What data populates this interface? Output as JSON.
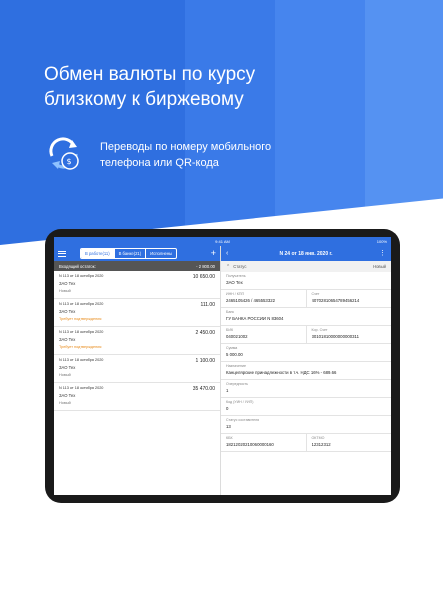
{
  "promo": {
    "headline_line1": "Обмен валюты по курсу",
    "headline_line2": "близкому к биржевому",
    "feature_line1": "Переводы по номеру мобильного",
    "feature_line2": "телефона или QR-кода"
  },
  "status_bar": {
    "time": "9:41 AM",
    "battery": "100%"
  },
  "left_panel": {
    "tabs": [
      "В работе(11)",
      "В банке(21)",
      "Исполнены"
    ],
    "balance_label": "Входящий остаток:",
    "balance_value": "- 2 800.00",
    "documents": [
      {
        "title": "N 113 от 18 октября 2020",
        "amount": "10 650.00",
        "company": "ЗАО Тех",
        "status": "Новый",
        "status_type": "normal"
      },
      {
        "title": "N 113 от 18 октября 2020",
        "amount": "111.00",
        "company": "ЗАО Тех",
        "status": "Требует подтверждения",
        "status_type": "warn"
      },
      {
        "title": "N 113 от 18 октября 2020",
        "amount": "2 450.00",
        "company": "ЗАО Тех",
        "status": "Требует подтверждения",
        "status_type": "warn"
      },
      {
        "title": "N 113 от 18 октября 2020",
        "amount": "1 100.00",
        "company": "ЗАО Тех",
        "status": "Новый",
        "status_type": "normal"
      },
      {
        "title": "N 113 от 18 октября 2020",
        "amount": "35 470.00",
        "company": "ЗАО Тех",
        "status": "Новый",
        "status_type": "normal"
      }
    ]
  },
  "right_panel": {
    "title": "N 24 от 18 янв. 2020 г.",
    "status_label": "Статус",
    "status_value": "Новый",
    "recipient_label": "Получатель",
    "recipient_value": "ЗАО Тех",
    "inn_label": "ИНН / КПП",
    "inn_value": "2465105426 / 465553322",
    "account_label": "Счет",
    "account_value": "40702810654789456214",
    "bank_label": "Банк",
    "bank_value": "ГУ БАНКА РОССИИ N 83604",
    "bik_label": "БИК",
    "bik_value": "040021002",
    "corr_label": "Кор. Счет",
    "corr_value": "30101810000000000311",
    "sum_label": "Сумма",
    "sum_value": "5 000.00",
    "purpose_label": "Назначение",
    "purpose_value": "Канцелярские принадлежности в т.ч. НДС 16% - 689.66",
    "order_label": "Очередность",
    "order_value": "1",
    "code_label": "Код (УИН / УИП)",
    "code_value": "0",
    "compiler_label": "Статус составителя",
    "compiler_value": "13",
    "kbk_label": "КБК",
    "kbk_value": "18212020210060000160",
    "oktmo_label": "ОКТМО",
    "oktmo_value": "12312312"
  }
}
